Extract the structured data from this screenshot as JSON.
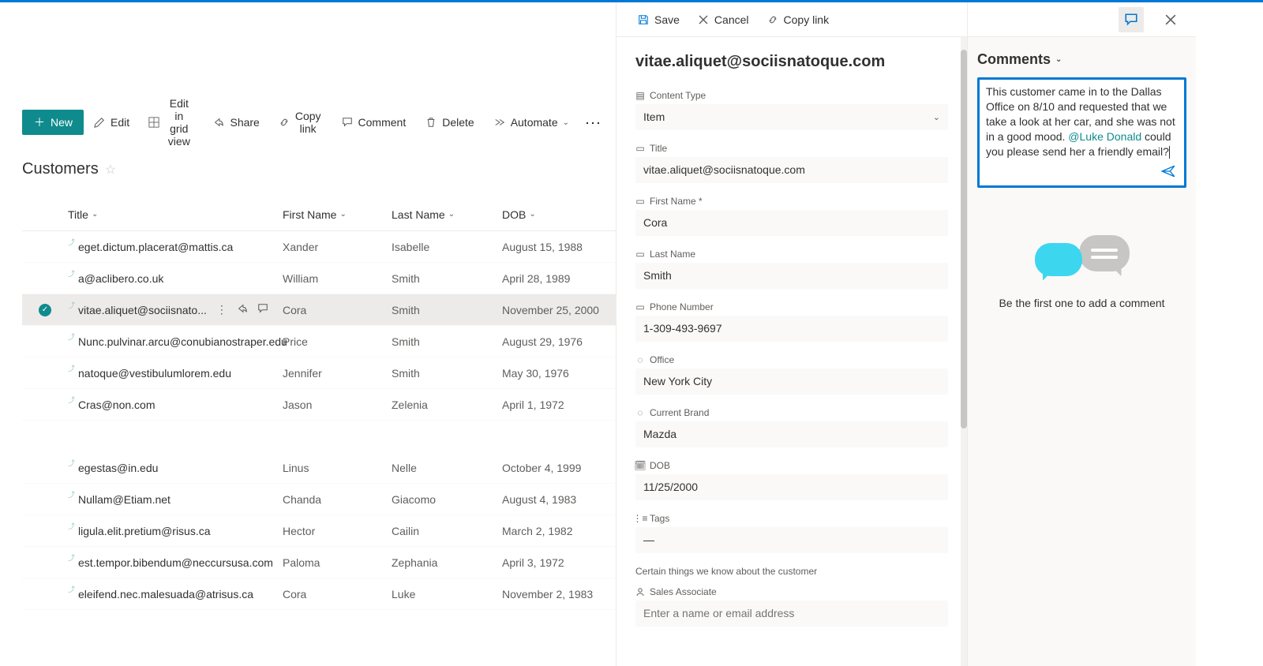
{
  "toolbar": {
    "new": "New",
    "edit": "Edit",
    "edit_grid": "Edit in grid view",
    "share": "Share",
    "copy_link": "Copy link",
    "comment": "Comment",
    "delete": "Delete",
    "automate": "Automate"
  },
  "list": {
    "title": "Customers",
    "columns": {
      "title": "Title",
      "first_name": "First Name",
      "last_name": "Last Name",
      "dob": "DOB"
    },
    "rows": [
      {
        "title": "eget.dictum.placerat@mattis.ca",
        "first_name": "Xander",
        "last_name": "Isabelle",
        "dob": "August 15, 1988",
        "selected": false
      },
      {
        "title": "a@aclibero.co.uk",
        "first_name": "William",
        "last_name": "Smith",
        "dob": "April 28, 1989",
        "selected": false
      },
      {
        "title": "vitae.aliquet@sociisnato...",
        "first_name": "Cora",
        "last_name": "Smith",
        "dob": "November 25, 2000",
        "selected": true
      },
      {
        "title": "Nunc.pulvinar.arcu@conubianostraper.edu",
        "first_name": "Price",
        "last_name": "Smith",
        "dob": "August 29, 1976",
        "selected": false
      },
      {
        "title": "natoque@vestibulumlorem.edu",
        "first_name": "Jennifer",
        "last_name": "Smith",
        "dob": "May 30, 1976",
        "selected": false
      },
      {
        "title": "Cras@non.com",
        "first_name": "Jason",
        "last_name": "Zelenia",
        "dob": "April 1, 1972",
        "selected": false
      },
      {
        "title": "egestas@in.edu",
        "first_name": "Linus",
        "last_name": "Nelle",
        "dob": "October 4, 1999",
        "selected": false
      },
      {
        "title": "Nullam@Etiam.net",
        "first_name": "Chanda",
        "last_name": "Giacomo",
        "dob": "August 4, 1983",
        "selected": false
      },
      {
        "title": "ligula.elit.pretium@risus.ca",
        "first_name": "Hector",
        "last_name": "Cailin",
        "dob": "March 2, 1982",
        "selected": false
      },
      {
        "title": "est.tempor.bibendum@neccursusa.com",
        "first_name": "Paloma",
        "last_name": "Zephania",
        "dob": "April 3, 1972",
        "selected": false
      },
      {
        "title": "eleifend.nec.malesuada@atrisus.ca",
        "first_name": "Cora",
        "last_name": "Luke",
        "dob": "November 2, 1983",
        "selected": false
      }
    ]
  },
  "detail": {
    "toolbar": {
      "save": "Save",
      "cancel": "Cancel",
      "copy_link": "Copy link"
    },
    "heading": "vitae.aliquet@sociisnatoque.com",
    "fields": {
      "content_type": {
        "label": "Content Type",
        "value": "Item"
      },
      "title": {
        "label": "Title",
        "value": "vitae.aliquet@sociisnatoque.com"
      },
      "first_name": {
        "label": "First Name *",
        "value": "Cora"
      },
      "last_name": {
        "label": "Last Name",
        "value": "Smith"
      },
      "phone": {
        "label": "Phone Number",
        "value": "1-309-493-9697"
      },
      "office": {
        "label": "Office",
        "value": "New York City"
      },
      "brand": {
        "label": "Current Brand",
        "value": "Mazda"
      },
      "dob": {
        "label": "DOB",
        "value": "11/25/2000"
      },
      "tags": {
        "label": "Tags",
        "value": "—"
      },
      "helper": "Certain things we know about the customer",
      "sales_assoc": {
        "label": "Sales Associate",
        "placeholder": "Enter a name or email address"
      }
    }
  },
  "comments": {
    "title": "Comments",
    "draft_before": "This customer came in to the Dallas Office on 8/10 and requested that we take a look at her car, and she was not in a good mood. ",
    "draft_mention": "@Luke Donald",
    "draft_after": " could you please send her a friendly email?",
    "empty": "Be the first one to add a comment"
  }
}
